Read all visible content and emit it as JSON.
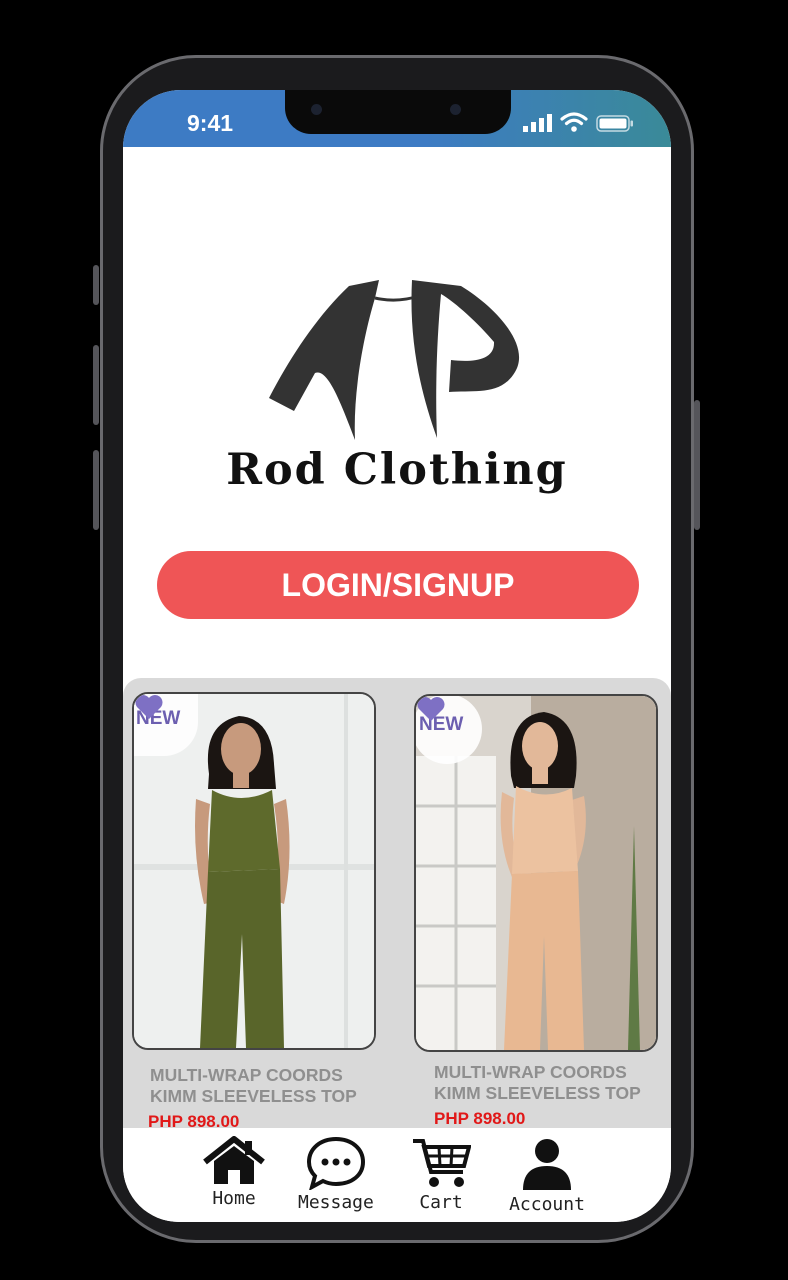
{
  "status_bar": {
    "time": "9:41"
  },
  "brand": {
    "name": "Rod Clothing"
  },
  "auth": {
    "login_label": "LOGIN/SIGNUP"
  },
  "products": [
    {
      "badge": "NEW",
      "line1": "MULTI-WRAP COORDS",
      "line2": "KIMM SLEEVELESS TOP",
      "price": "PHP 898.00",
      "color": "#5e6a2c"
    },
    {
      "badge": "NEW",
      "line1": "MULTI-WRAP COORDS",
      "line2": "KIMM SLEEVELESS TOP",
      "price": "PHP 898.00",
      "color": "#e8b892"
    }
  ],
  "nav": {
    "home": "Home",
    "message": "Message",
    "cart": "Cart",
    "account": "Account"
  },
  "colors": {
    "accent": "#ef5556",
    "price": "#e11818",
    "badge": "#6c5fb0",
    "status_bar": "#3d7bc4"
  }
}
